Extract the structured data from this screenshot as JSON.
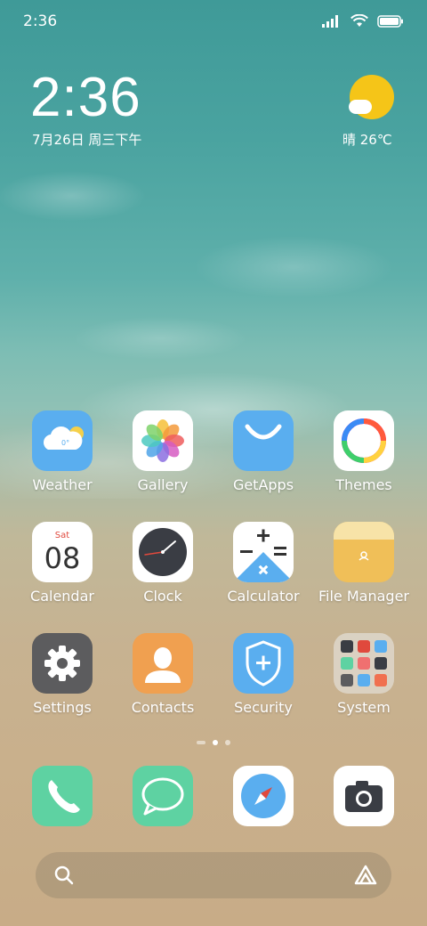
{
  "status_bar": {
    "time": "2:36"
  },
  "widget": {
    "time": "2:36",
    "date": "7月26日 周三下午",
    "weather": "晴 26℃"
  },
  "apps": [
    {
      "label": "Weather",
      "icon": "weather-icon",
      "temp": "0°"
    },
    {
      "label": "Gallery",
      "icon": "gallery-icon"
    },
    {
      "label": "GetApps",
      "icon": "getapps-icon"
    },
    {
      "label": "Themes",
      "icon": "themes-icon"
    },
    {
      "label": "Calendar",
      "icon": "calendar-icon",
      "day": "Sat",
      "date": "08"
    },
    {
      "label": "Clock",
      "icon": "clock-icon"
    },
    {
      "label": "Calculator",
      "icon": "calculator-icon"
    },
    {
      "label": "File Manager",
      "icon": "folder-icon"
    },
    {
      "label": "Settings",
      "icon": "gear-icon"
    },
    {
      "label": "Contacts",
      "icon": "contact-icon"
    },
    {
      "label": "Security",
      "icon": "shield-icon"
    },
    {
      "label": "System",
      "icon": "folder-grid-icon"
    }
  ],
  "dock": [
    {
      "icon": "phone-icon"
    },
    {
      "icon": "messages-icon"
    },
    {
      "icon": "browser-compass-icon"
    },
    {
      "icon": "camera-icon"
    }
  ],
  "colors": {
    "weather_blue": "#5aaeef",
    "getapps_blue": "#5aaeef",
    "file_yellow": "#f0bf58",
    "settings_gray": "#5c5c5e",
    "contacts_orange": "#f0a050",
    "security_blue": "#5aaeef",
    "dock_green": "#5ed2a2",
    "sun_yellow": "#f5c518"
  }
}
